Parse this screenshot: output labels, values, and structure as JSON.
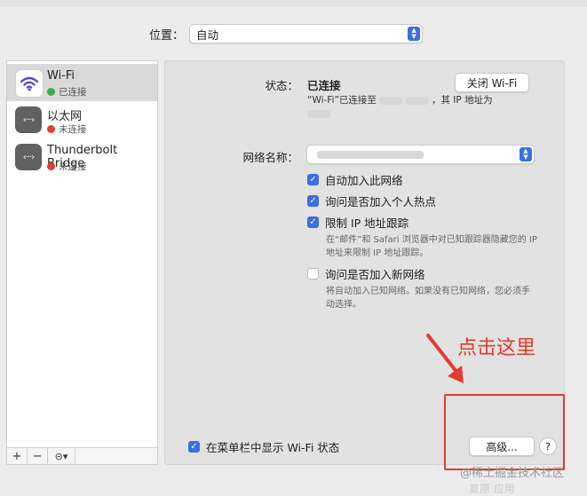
{
  "location": {
    "label": "位置：",
    "value": "自动"
  },
  "services": [
    {
      "name": "Wi-Fi",
      "status": "已连接",
      "icon": "wifi-icon",
      "status_color": "#37b34a"
    },
    {
      "name": "以太网",
      "status": "未连接",
      "icon": "ethernet-icon",
      "status_color": "#de3e34"
    },
    {
      "name": "Thunderbolt Bridge",
      "status": "未连接",
      "icon": "thunderbolt-bridge-icon",
      "status_color": "#de3e34"
    }
  ],
  "sidebar_controls": {
    "add": "+",
    "remove": "−",
    "action": "⊝▾"
  },
  "wifi": {
    "status_label": "状态：",
    "status_value": "已连接",
    "toggle_button": "关闭 Wi-Fi",
    "status_desc_1": "“Wi-Fi”已连接至",
    "status_desc_2": "，其 IP 地址为",
    "network_name_label": "网络名称：",
    "network_name_value": "",
    "auto_join": "自动加入此网络",
    "ask_hotspot": "询问是否加入个人热点",
    "limit_ip": "限制 IP 地址跟踪",
    "limit_ip_hint_1": "在“邮件”和 Safari 浏览器中对已知跟踪器隐藏您的 IP",
    "limit_ip_hint_2": "地址来限制 IP 地址跟踪。",
    "ask_new": "询问是否加入新网络",
    "ask_new_hint_1": "将自动加入已知网络。如果没有已知网络，您必须手",
    "ask_new_hint_2": "动选择。",
    "show_menu_bar": "在菜单栏中显示 Wi-Fi 状态",
    "advanced_button": "高级...",
    "help": "?"
  },
  "annotation": {
    "text": "点击这里",
    "color": "#e33b2e"
  },
  "watermark": "@稀土掘金技术社区",
  "bottom_buttons": "复原   应用",
  "accent_color": "#3b6ee0"
}
